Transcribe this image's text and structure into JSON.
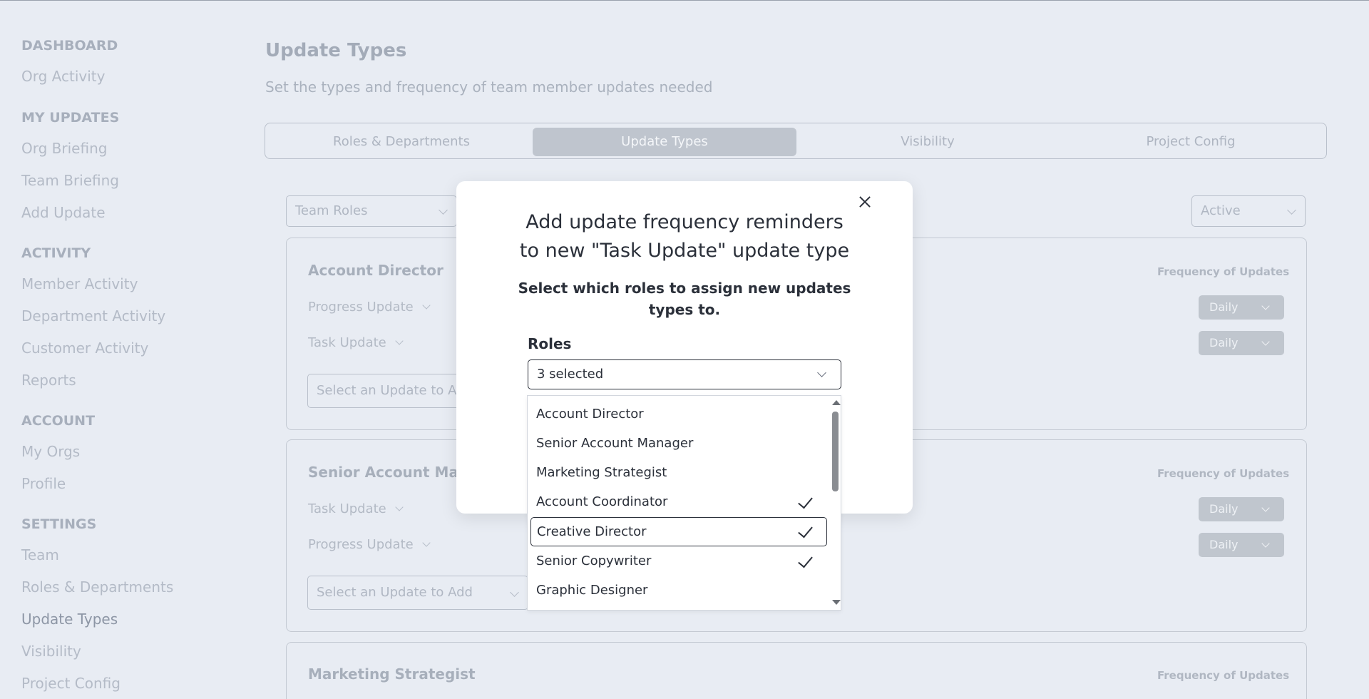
{
  "sidebar": {
    "sections": [
      {
        "heading": "DASHBOARD",
        "items": [
          "Org Activity"
        ]
      },
      {
        "heading": "MY UPDATES",
        "items": [
          "Org Briefing",
          "Team Briefing",
          "Add Update"
        ]
      },
      {
        "heading": "ACTIVITY",
        "items": [
          "Member Activity",
          "Department Activity",
          "Customer Activity",
          "Reports"
        ]
      },
      {
        "heading": "ACCOUNT",
        "items": [
          "My Orgs",
          "Profile"
        ]
      },
      {
        "heading": "SETTINGS",
        "items": [
          "Team",
          "Roles & Departments",
          "Update Types",
          "Visibility",
          "Project Config"
        ]
      }
    ],
    "active_item": "Update Types"
  },
  "page": {
    "title": "Update Types",
    "subtitle": "Set the types and frequency of team member updates needed"
  },
  "tabs": [
    "Roles & Departments",
    "Update Types",
    "Visibility",
    "Project Config"
  ],
  "active_tab": "Update Types",
  "filters": {
    "left": "Team Roles",
    "right": "Active"
  },
  "cards": [
    {
      "title": "Account Director",
      "freq_label": "Frequency of Updates",
      "updates": [
        {
          "name": "Progress Update",
          "freq": "Daily"
        },
        {
          "name": "Task Update",
          "freq": "Daily"
        }
      ],
      "add_placeholder": "Select an Update to Add"
    },
    {
      "title": "Senior Account Manager",
      "freq_label": "Frequency of Updates",
      "updates": [
        {
          "name": "Task Update",
          "freq": "Daily"
        },
        {
          "name": "Progress Update",
          "freq": "Daily"
        }
      ],
      "add_placeholder": "Select an Update to Add"
    },
    {
      "title": "Marketing Strategist",
      "freq_label": "Frequency of Updates"
    }
  ],
  "modal": {
    "title_line1": "Add update frequency reminders",
    "title_line2": "to new \"Task Update\" update type",
    "subtitle": "Select which roles to assign new updates types to.",
    "roles_label": "Roles",
    "roles_value": "3 selected",
    "options": [
      {
        "label": "Account Director",
        "selected": false
      },
      {
        "label": "Senior Account Manager",
        "selected": false
      },
      {
        "label": "Marketing Strategist",
        "selected": false
      },
      {
        "label": "Account Coordinator",
        "selected": true
      },
      {
        "label": "Creative Director",
        "selected": true,
        "focused": true
      },
      {
        "label": "Senior Copywriter",
        "selected": true
      },
      {
        "label": "Graphic Designer",
        "selected": false
      }
    ]
  },
  "icons": {
    "close": "close-icon",
    "check": "checkmark-icon",
    "chevron": "chevron-down-icon"
  }
}
